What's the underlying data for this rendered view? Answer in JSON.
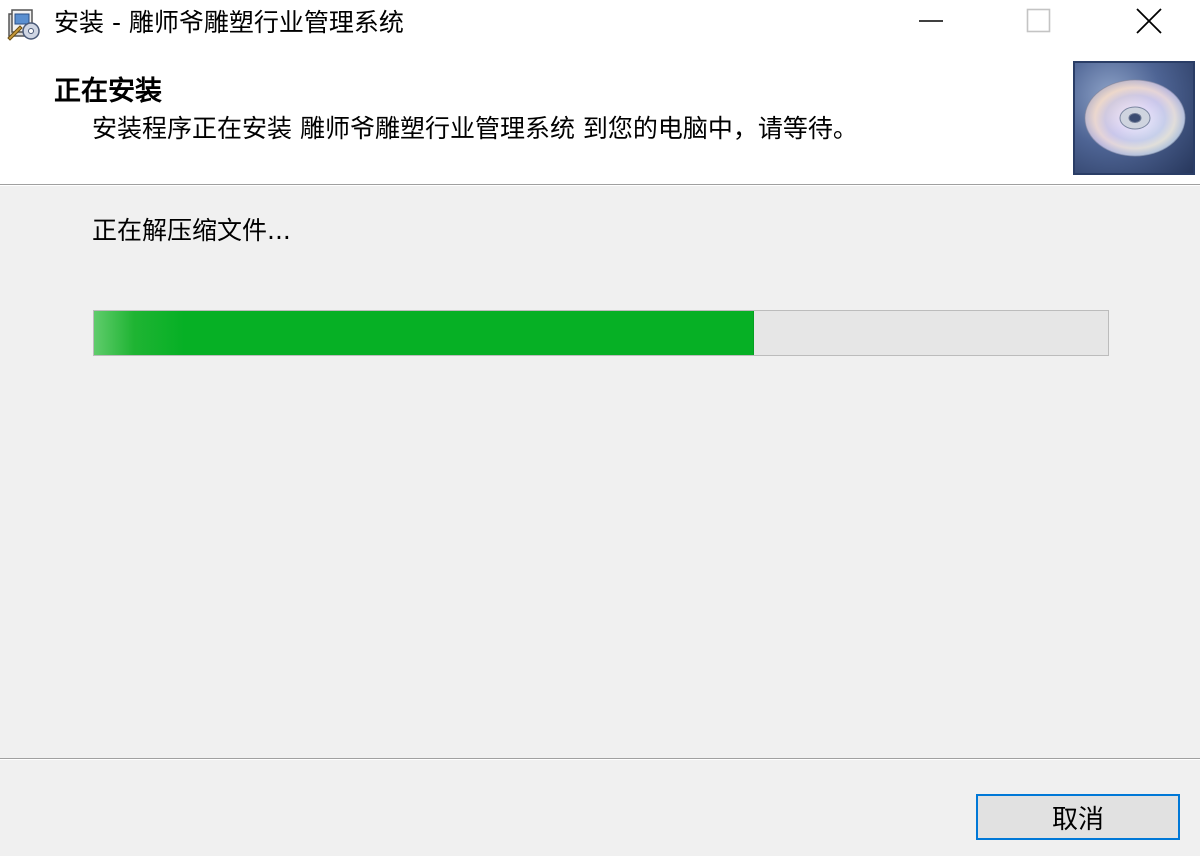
{
  "window": {
    "title": "安装 - 雕师爷雕塑行业管理系统",
    "icons": {
      "app": "installer-app-icon",
      "minimize": "minimize-icon",
      "maximize": "maximize-icon",
      "close": "close-icon",
      "header_image": "cd-disc-icon"
    }
  },
  "header": {
    "title": "正在安装",
    "subtitle": "安装程序正在安装 雕师爷雕塑行业管理系统 到您的电脑中，请等待。"
  },
  "main": {
    "status": "正在解压缩文件...",
    "progress_percent": 65,
    "progress_color": "#06b025"
  },
  "footer": {
    "cancel_label": "取消"
  }
}
